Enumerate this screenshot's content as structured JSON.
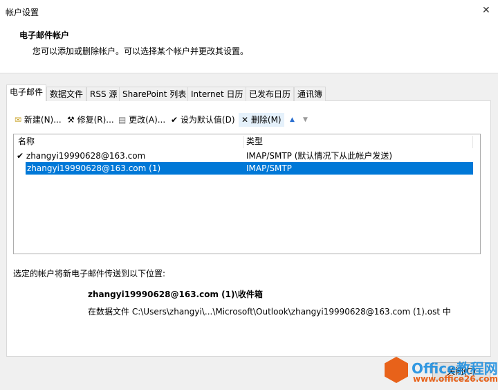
{
  "window": {
    "title": "帐户设置",
    "close": "✕"
  },
  "header": {
    "title": "电子邮件帐户",
    "subtitle": "您可以添加或删除帐户。可以选择某个帐户并更改其设置。"
  },
  "tabs": [
    "电子邮件",
    "数据文件",
    "RSS 源",
    "SharePoint 列表",
    "Internet 日历",
    "已发布日历",
    "通讯簿"
  ],
  "toolbar": {
    "new": "新建(N)...",
    "repair": "修复(R)...",
    "change": "更改(A)...",
    "set_default": "设为默认值(D)",
    "remove": "删除(M)"
  },
  "list": {
    "columns": [
      "名称",
      "类型"
    ],
    "rows": [
      {
        "name": "zhangyi19990628@163.com",
        "type": "IMAP/SMTP (默认情况下从此帐户发送)"
      },
      {
        "name": "zhangyi19990628@163.com (1)",
        "type": "IMAP/SMTP"
      }
    ]
  },
  "delivery": {
    "label": "选定的帐户将新电子邮件传送到以下位置:",
    "folder": "zhangyi19990628@163.com (1)\\收件箱",
    "file": "在数据文件 C:\\Users\\zhangyi\\...\\Microsoft\\Outlook\\zhangyi19990628@163.com (1).ost 中"
  },
  "footer": {
    "close": "关闭(C)"
  },
  "watermark": {
    "brand": "Office教程网",
    "url": "www.office26.com"
  },
  "colors": {
    "selection": "#0078d7",
    "accent": "#e8621a"
  }
}
